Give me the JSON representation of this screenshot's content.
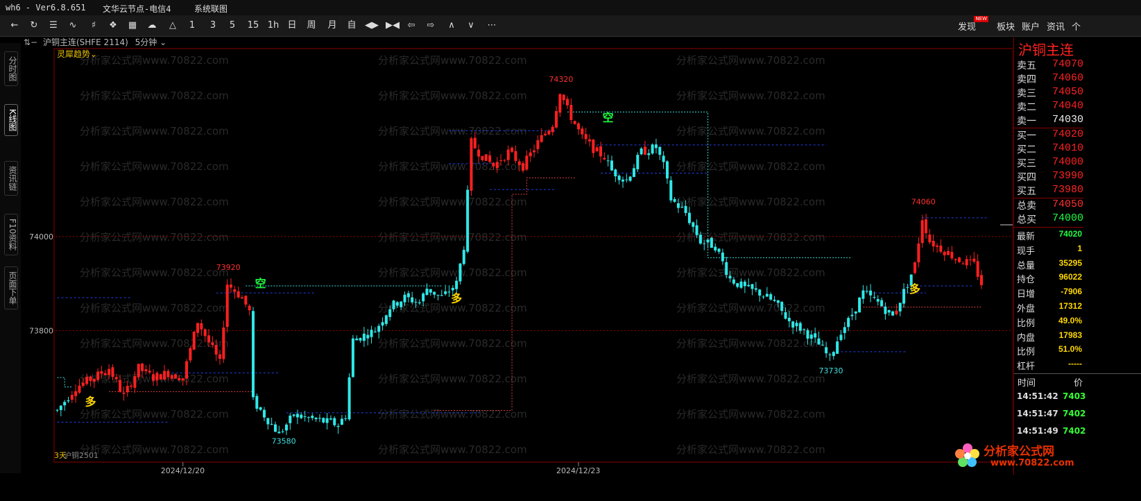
{
  "titlebar": {
    "app": "wh6 - Ver6.8.651",
    "server": "文华云节点-电信4",
    "menu": "系统联图"
  },
  "toolbar": {
    "periods": [
      "1",
      "3",
      "5",
      "15",
      "1h",
      "日",
      "周",
      "月",
      "自"
    ],
    "right_items": [
      "发现",
      "板块",
      "账户",
      "资讯",
      "个"
    ],
    "new_badge": "NEW"
  },
  "left_tabs": [
    "分时图",
    "K线图",
    "资讯链",
    "F10资料",
    "页面下单"
  ],
  "chart_header": {
    "symbol": "沪铜主连(SHFE 2114)",
    "period": "5分钟",
    "indicator": "灵犀趋势",
    "bottom_left": "3天",
    "bottom_contract": "沪铜2501"
  },
  "watermark_text": "分析家公式网www.70822.com",
  "logo": {
    "line1": "分析家公式网",
    "line2": "www.70822.com"
  },
  "chart_data": {
    "type": "candlestick",
    "ylim": [
      73520,
      74400
    ],
    "y_ticks": [
      74000,
      73800
    ],
    "x_labels": [
      {
        "label": "2024/12/20",
        "index": 34
      },
      {
        "label": "2024/12/23",
        "index": 141
      }
    ],
    "price_labels": [
      {
        "text": "74320",
        "index": 136,
        "value": 74320,
        "color": "#ff3030",
        "pos": "above"
      },
      {
        "text": "73920",
        "index": 46,
        "value": 73920,
        "color": "#ff3030",
        "pos": "above"
      },
      {
        "text": "73580",
        "index": 61,
        "value": 73580,
        "color": "#40e0e0",
        "pos": "below"
      },
      {
        "text": "73730",
        "index": 209,
        "value": 73730,
        "color": "#40e0e0",
        "pos": "below"
      },
      {
        "text": "74060",
        "index": 234,
        "value": 74060,
        "color": "#ff3030",
        "pos": "above"
      }
    ],
    "signals": [
      {
        "text": "多",
        "index": 9,
        "value": 73640,
        "color": "#ffd700"
      },
      {
        "text": "空",
        "index": 55,
        "value": 73892,
        "color": "#20ff40"
      },
      {
        "text": "多",
        "index": 108,
        "value": 73860,
        "color": "#ffd700"
      },
      {
        "text": "空",
        "index": 149,
        "value": 74245,
        "color": "#20ff40"
      },
      {
        "text": "多",
        "index": 232,
        "value": 73880,
        "color": "#ffd700"
      }
    ],
    "h_dotted_red": [
      74000,
      73800
    ],
    "candles": []
  },
  "quote_panel": {
    "title": "沪铜主连",
    "asks": [
      {
        "label": "卖五",
        "price": "74070"
      },
      {
        "label": "卖四",
        "price": "74060"
      },
      {
        "label": "卖三",
        "price": "74050"
      },
      {
        "label": "卖二",
        "price": "74040"
      },
      {
        "label": "卖一",
        "price": "74030"
      }
    ],
    "bids": [
      {
        "label": "买一",
        "price": "74020"
      },
      {
        "label": "买二",
        "price": "74010"
      },
      {
        "label": "买三",
        "price": "74000"
      },
      {
        "label": "买四",
        "price": "73990"
      },
      {
        "label": "买五",
        "price": "73980"
      }
    ],
    "totals": [
      {
        "label": "总卖",
        "value": "74050",
        "color": "#ff3030"
      },
      {
        "label": "总买",
        "value": "74000",
        "color": "#20ff40"
      }
    ],
    "stats": [
      {
        "label": "最新",
        "value": "74020",
        "color": "#20ff40"
      },
      {
        "label": "现手",
        "value": "1",
        "color": "#ffd700"
      },
      {
        "label": "总量",
        "value": "35295",
        "color": "#ffd700"
      },
      {
        "label": "持仓",
        "value": "96022",
        "color": "#ffd700"
      },
      {
        "label": "日增",
        "value": "-7906",
        "color": "#ffd700"
      },
      {
        "label": "外盘",
        "value": "17312",
        "color": "#ffd700"
      },
      {
        "label": "比例",
        "value": "49.0%",
        "color": "#ffd700"
      },
      {
        "label": "内盘",
        "value": "17983",
        "color": "#ffd700"
      },
      {
        "label": "比例",
        "value": "51.0%",
        "color": "#ffd700"
      },
      {
        "label": "杠杆",
        "value": "-----",
        "color": "#ffd700"
      }
    ],
    "ticks_header": [
      "时间",
      "价"
    ],
    "ticks": [
      {
        "time": "14:51:42",
        "price": "7403"
      },
      {
        "time": "14:51:47",
        "price": "7402"
      },
      {
        "time": "14:51:49",
        "price": "7402"
      }
    ]
  }
}
